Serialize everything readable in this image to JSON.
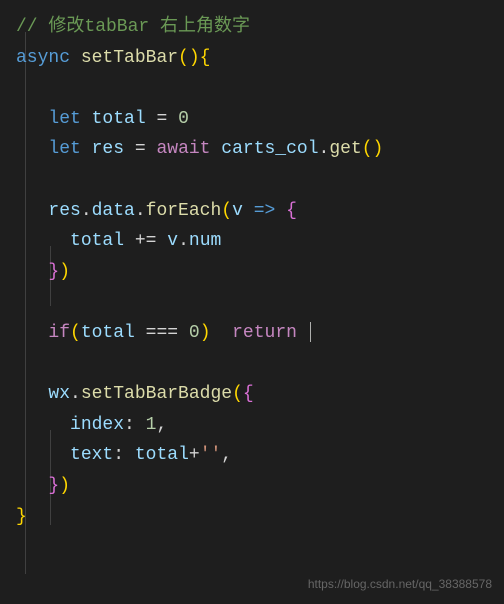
{
  "code": {
    "comment": "// 修改tabBar 右上角数字",
    "async": "async",
    "funcName": "setTabBar",
    "let1": "let",
    "total": "total",
    "eq": "=",
    "zero": "0",
    "let2": "let",
    "res": "res",
    "await": "await",
    "cartsCol": "carts_col",
    "dot": ".",
    "get": "get",
    "data": "data",
    "forEach": "forEach",
    "v": "v",
    "arrow": "=>",
    "plusEq": "+=",
    "num": "num",
    "if": "if",
    "tripleEq": "===",
    "return": "return",
    "wx": "wx",
    "setTabBarBadge": "setTabBarBadge",
    "index": "index",
    "one": "1",
    "comma": ",",
    "text": "text",
    "plus": "+",
    "emptyStr": "''",
    "lparen": "(",
    "rparen": ")",
    "lbrace": "{",
    "rbrace": "}",
    "colon": ":"
  },
  "watermark": "https://blog.csdn.net/qq_38388578"
}
